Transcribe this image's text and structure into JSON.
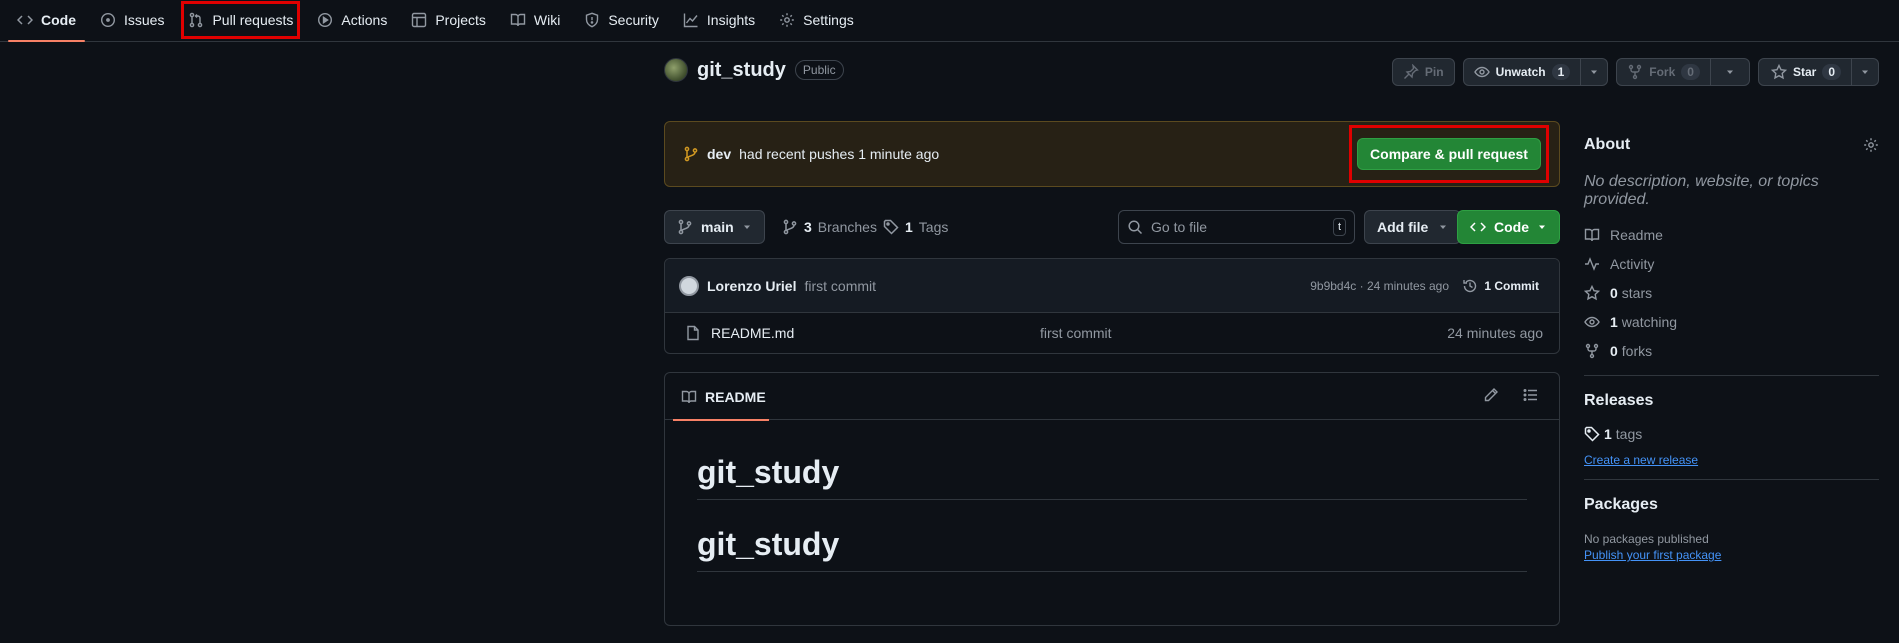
{
  "nav": {
    "tabs": [
      {
        "label": "Code",
        "icon": "code-icon"
      },
      {
        "label": "Issues",
        "icon": "issue-opened-icon"
      },
      {
        "label": "Pull requests",
        "icon": "git-pull-request-icon"
      },
      {
        "label": "Actions",
        "icon": "play-icon"
      },
      {
        "label": "Projects",
        "icon": "table-icon"
      },
      {
        "label": "Wiki",
        "icon": "book-icon"
      },
      {
        "label": "Security",
        "icon": "shield-icon"
      },
      {
        "label": "Insights",
        "icon": "graph-icon"
      },
      {
        "label": "Settings",
        "icon": "gear-icon"
      }
    ]
  },
  "repo": {
    "name": "git_study",
    "visibility": "Public"
  },
  "actions": {
    "pin": "Pin",
    "unwatch": "Unwatch",
    "unwatch_count": "1",
    "fork": "Fork",
    "fork_count": "0",
    "star": "Star",
    "star_count": "0"
  },
  "banner": {
    "branch": "dev",
    "text": "had recent pushes 1 minute ago",
    "button": "Compare & pull request"
  },
  "branch_bar": {
    "branch": "main",
    "branches_count": "3",
    "branches_label": "Branches",
    "tags_count": "1",
    "tags_label": "Tags",
    "search_placeholder": "Go to file",
    "search_shortcut": "t",
    "add_file": "Add file",
    "code": "Code"
  },
  "latest_commit": {
    "author": "Lorenzo Uriel",
    "message": "first commit",
    "meta": "9b9bd4c · 24 minutes ago",
    "commit_count": "1 Commit"
  },
  "files": [
    {
      "name": "README.md",
      "message": "first commit",
      "age": "24 minutes ago"
    }
  ],
  "readme": {
    "tab": "README",
    "headings": [
      "git_study",
      "git_study"
    ]
  },
  "sidebar": {
    "about_title": "About",
    "about_desc": "No description, website, or topics provided.",
    "items": [
      {
        "count": "",
        "label": "Readme"
      },
      {
        "count": "",
        "label": "Activity"
      },
      {
        "count": "0",
        "label": "stars"
      },
      {
        "count": "1",
        "label": "watching"
      },
      {
        "count": "0",
        "label": "forks"
      }
    ],
    "releases_title": "Releases",
    "tags_count": "1",
    "tags_label": "tags",
    "create_release": "Create a new release",
    "packages_title": "Packages",
    "no_packages": "No packages published",
    "publish_package": "Publish your first package"
  },
  "colors": {
    "background": "#0d1117",
    "accent_green": "#238636",
    "link_blue": "#4493f8",
    "tab_underline": "#f78166",
    "highlight_red": "#e00000"
  }
}
